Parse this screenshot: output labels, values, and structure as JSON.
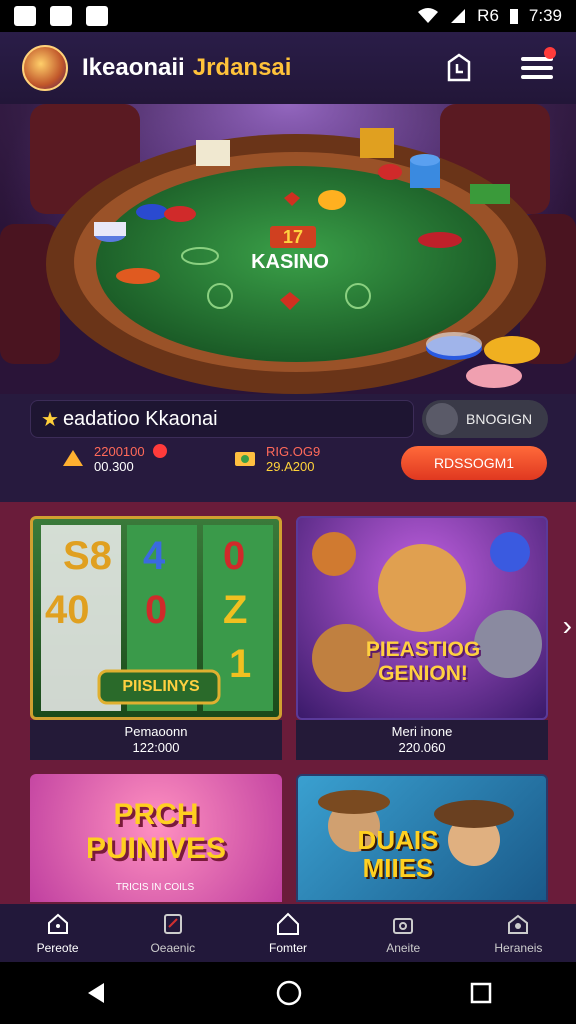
{
  "status": {
    "time": "7:39",
    "signal": "R6"
  },
  "header": {
    "title_part1": "Ikeaonaii",
    "title_part2": "Jrdansai"
  },
  "hero": {
    "table_brand": "KASINO",
    "table_number": "17"
  },
  "search": {
    "text": "eadatioo Kkaonai",
    "toggle_label": "BNOGIGN"
  },
  "stats": [
    {
      "value1": "2200100",
      "value2": "00.300"
    },
    {
      "value1": "RIG.OG9",
      "value2": "29.A200"
    }
  ],
  "cta_label": "RDSSOGM1",
  "cards": [
    {
      "title": "Pemaoonn",
      "amount": "122:000",
      "art_label": "PIISLINYS"
    },
    {
      "title": "Meri inone",
      "amount": "220.060",
      "art_label": "PIEASTIOG GENION!"
    },
    {
      "title": "",
      "amount": "",
      "art_label": "PRCH PUINIVES",
      "sub": "TRICIS IN COILS"
    },
    {
      "title": "",
      "amount": "",
      "art_label": "DUAIS MIIES"
    }
  ],
  "nav": [
    {
      "label": "Pereote"
    },
    {
      "label": "Oeaenic"
    },
    {
      "label": "Fomter"
    },
    {
      "label": "Aneite"
    },
    {
      "label": "Heraneis"
    }
  ],
  "colors": {
    "accent": "#ff5a30",
    "gold": "#ffc23a",
    "bg": "#1a1230",
    "grid_bg": "#6a1c3a"
  }
}
